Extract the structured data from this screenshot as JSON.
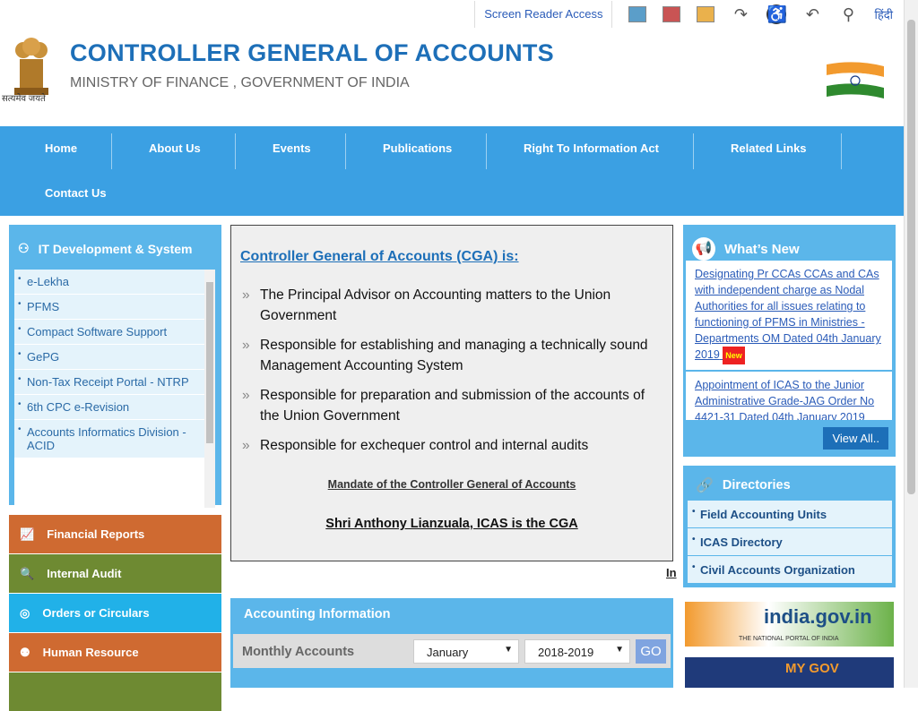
{
  "topbar": {
    "screen_reader": "Screen Reader Access",
    "lang": "हिंदी"
  },
  "header": {
    "title": "CONTROLLER GENERAL OF ACCOUNTS",
    "subtitle": "MINISTRY OF FINANCE , GOVERNMENT OF INDIA",
    "motto": "सत्यमेव जयते"
  },
  "nav": {
    "items": [
      "Home",
      "About Us",
      "Events",
      "Publications",
      "Right To Information Act",
      "Related Links",
      "Contact Us"
    ]
  },
  "it": {
    "title": "IT Development & System",
    "items": [
      "e-Lekha",
      "PFMS",
      "Compact Software Support",
      "GePG",
      "Non-Tax Receipt Portal - NTRP",
      "6th CPC e-Revision",
      "Accounts Informatics Division - ACID"
    ]
  },
  "tiles": [
    "Financial Reports",
    "Internal Audit",
    "Orders or Circulars",
    "Human Resource"
  ],
  "cga": {
    "heading": "Controller General of Accounts (CGA) is:",
    "points": [
      "The Principal Advisor on Accounting matters to the Union Government",
      "Responsible for establishing and managing a technically sound Management Accounting System",
      "Responsible for preparation and submission of the accounts of the Union Government",
      "Responsible for exchequer control and internal audits"
    ],
    "mandate": "Mandate of the Controller General of Accounts",
    "cga_name": "Shri Anthony Lianzuala, ICAS is the CGA",
    "ticker": "In"
  },
  "whats_new": {
    "title": "What’s New",
    "items": [
      "Designating Pr CCAs CCAs and CAs with independent charge as Nodal Authorities for all issues relating to functioning of PFMS in Ministries - Departments OM Dated 04th January 2019",
      "Appointment of ICAS to the Junior Administrative Grade-JAG Order No 4421-31 Dated 04th January 2019"
    ],
    "badge": "New",
    "view_all": "View All.."
  },
  "directories": {
    "title": "Directories",
    "items": [
      "Field Accounting Units",
      "ICAS Directory",
      "Civil Accounts Organization"
    ]
  },
  "accounting": {
    "title": "Accounting Information",
    "label": "Monthly Accounts",
    "month": "January",
    "year": "2018-2019",
    "go": "GO"
  },
  "banners": {
    "india": "india.gov.in",
    "india_sub": "THE NATIONAL PORTAL OF INDIA",
    "mygov": "MY GOV"
  }
}
